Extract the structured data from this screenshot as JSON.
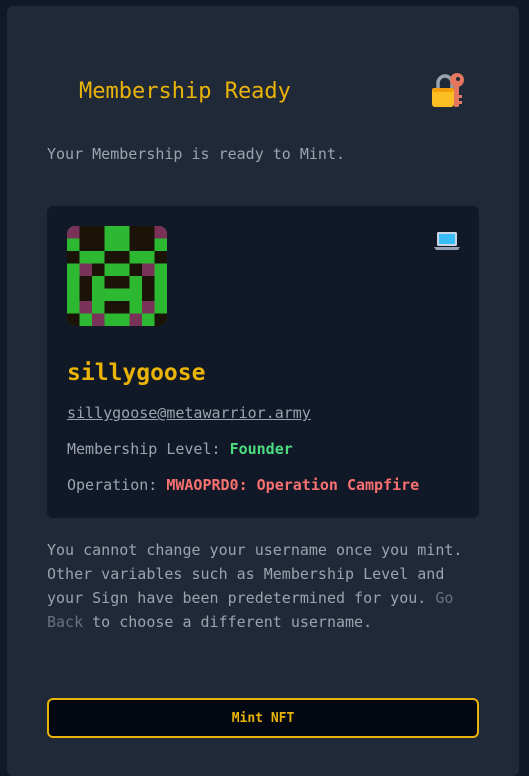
{
  "header": {
    "title": "Membership Ready",
    "icon": "locked-with-key-icon"
  },
  "intro_text": "Your Membership is ready to Mint.",
  "card": {
    "avatar_icon": "pixel-goblin-avatar",
    "device_icon": "laptop-icon",
    "username": "sillygoose",
    "email": "sillygoose@metawarrior.army",
    "membership_label": "Membership Level: ",
    "membership_value": "Founder",
    "operation_label": "Operation: ",
    "operation_value": "MWAOPRD0: Operation Campfire"
  },
  "notice": {
    "text_before": "You cannot change your username once you mint. Other variables such as Membership Level and your Sign have been predetermined for you. ",
    "link": "Go Back",
    "text_after": " to choose a different username."
  },
  "mint_button": {
    "label": "Mint NFT"
  },
  "colors": {
    "accent": "#eab308",
    "success": "#4ade80",
    "danger": "#f87171",
    "panel": "#1f2937",
    "card": "#111827"
  }
}
